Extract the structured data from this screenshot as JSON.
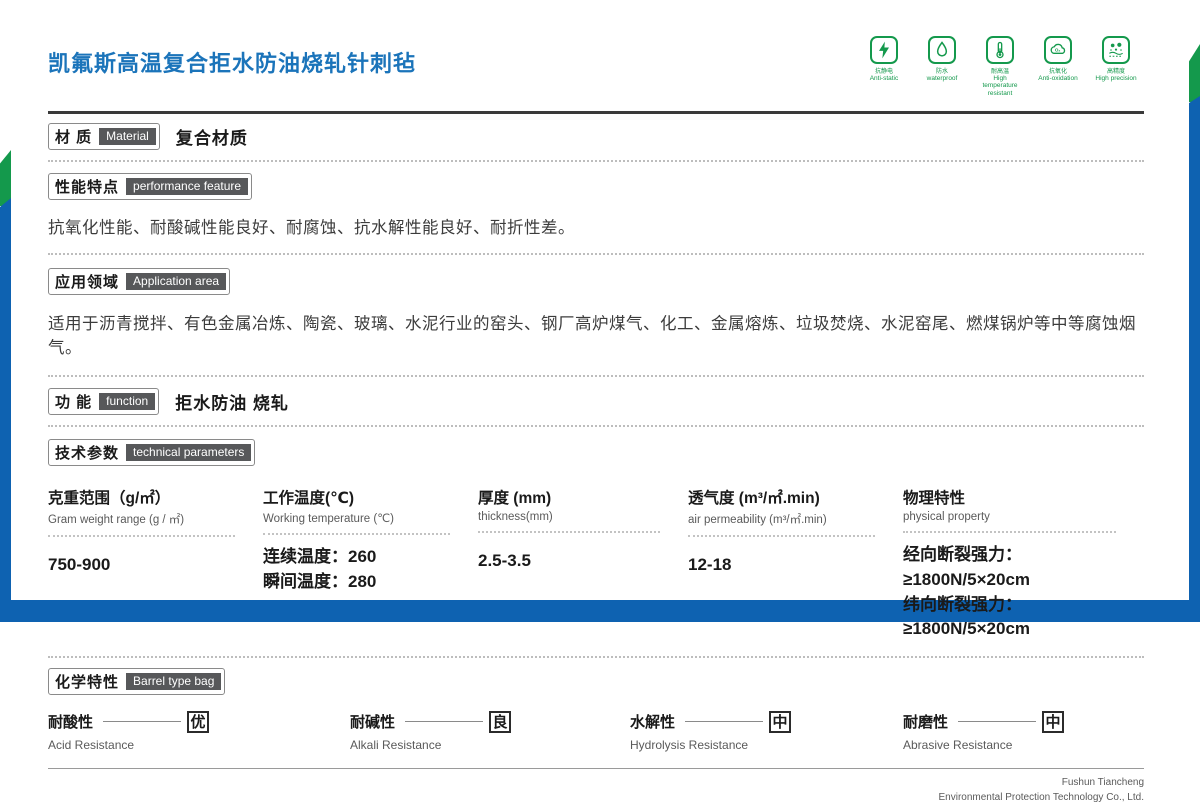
{
  "page": {
    "title": "凯氟斯高温复合拒水防油烧轧针刺毡"
  },
  "icons": [
    {
      "cn": "抗静电",
      "en": "Anti-static"
    },
    {
      "cn": "防水",
      "en": "waterproof"
    },
    {
      "cn": "耐高温",
      "en": "High temperature resistant"
    },
    {
      "cn": "抗氧化",
      "en": "Anti-oxidation"
    },
    {
      "cn": "高精度",
      "en": "High precision"
    }
  ],
  "material": {
    "label_cn": "材 质",
    "label_en": "Material",
    "value": "复合材质"
  },
  "performance": {
    "label_cn": "性能特点",
    "label_en": "performance feature",
    "text": "抗氧化性能、耐酸碱性能良好、耐腐蚀、抗水解性能良好、耐折性差。"
  },
  "application": {
    "label_cn": "应用领域",
    "label_en": "Application area",
    "text": "适用于沥青搅拌、有色金属冶炼、陶瓷、玻璃、水泥行业的窑头、钢厂高炉煤气、化工、金属熔炼、垃圾焚烧、水泥窑尾、燃煤锅炉等中等腐蚀烟气。"
  },
  "function": {
    "label_cn": "功 能",
    "label_en": "function",
    "value": "拒水防油 烧轧"
  },
  "technical": {
    "label_cn": "技术参数",
    "label_en": "technical parameters",
    "columns": [
      {
        "cn": "克重范围（g/㎡）",
        "en": "Gram weight range (g / ㎡)",
        "value": "750-900",
        "value2": ""
      },
      {
        "cn": "工作温度(℃)",
        "en": "Working temperature (℃)",
        "value": "连续温度：260",
        "value2": "瞬间温度：280"
      },
      {
        "cn": "厚度 (mm)",
        "en": "thickness(mm)",
        "value": "2.5-3.5",
        "value2": ""
      },
      {
        "cn": "透气度 (m³/㎡.min)",
        "en": "air permeability  (m³/㎡.min)",
        "value": "12-18",
        "value2": ""
      },
      {
        "cn": "物理特性",
        "en": "physical property",
        "value": "经向断裂强力：≥1800N/5×20cm",
        "value2": "纬向断裂强力：≥1800N/5×20cm"
      }
    ]
  },
  "chemical": {
    "label_cn": "化学特性",
    "label_en": "Barrel type bag",
    "items": [
      {
        "cn": "耐酸性",
        "en": "Acid Resistance",
        "grade": "优"
      },
      {
        "cn": "耐碱性",
        "en": "Alkali Resistance",
        "grade": "良"
      },
      {
        "cn": "水解性",
        "en": "Hydrolysis Resistance",
        "grade": "中"
      },
      {
        "cn": "耐磨性",
        "en": "Abrasive Resistance",
        "grade": "中"
      }
    ]
  },
  "footer": {
    "line1": "Fushun Tiancheng",
    "line2": "Environmental Protection Technology Co., Ltd."
  },
  "colors": {
    "accent_blue": "#0e62b1",
    "accent_green": "#14994c",
    "title_blue": "#1b74ba"
  }
}
